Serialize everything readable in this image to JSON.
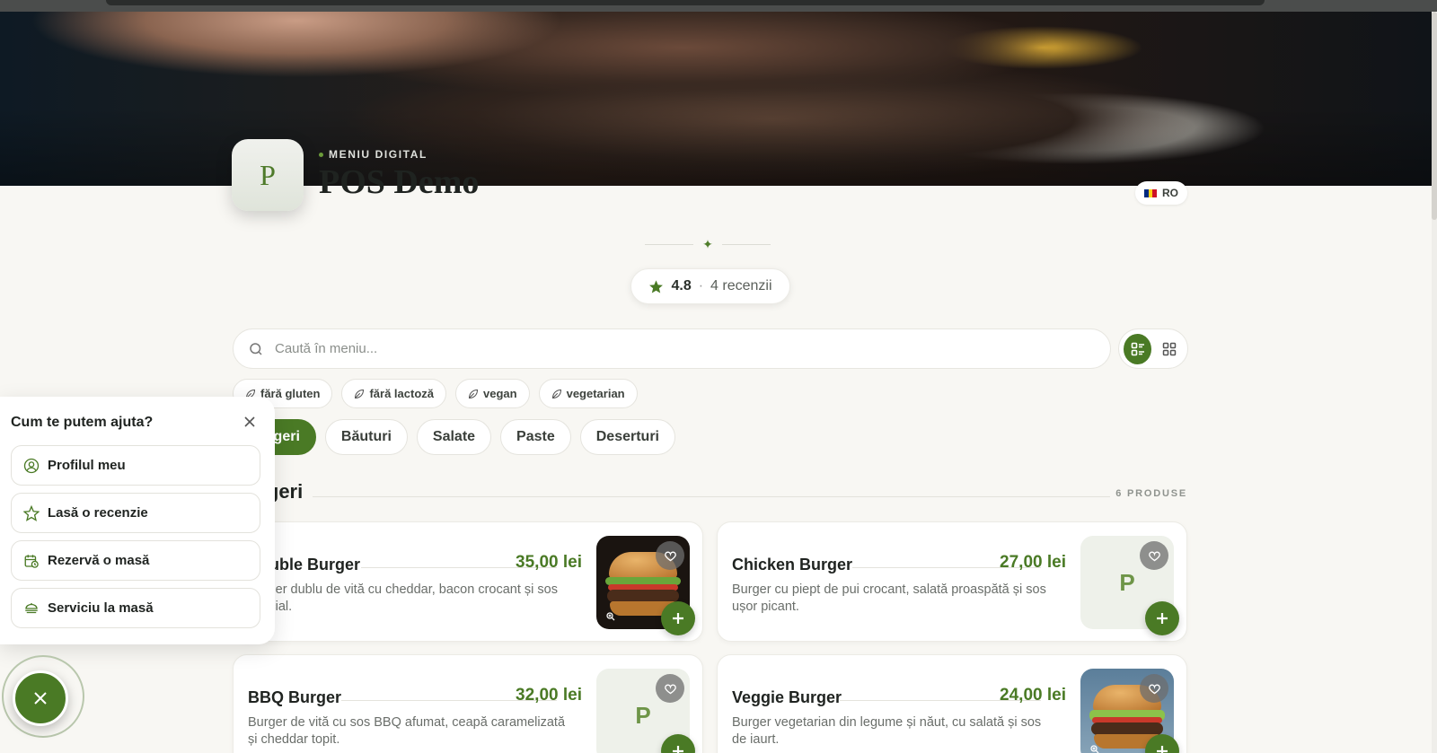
{
  "header": {
    "eyebrow": "MENIU DIGITAL",
    "brand_name": "POS Demo",
    "logo_letter": "P",
    "language": "RO"
  },
  "rating": {
    "score": "4.8",
    "separator": "·",
    "count_label": "4 recenzii"
  },
  "search": {
    "placeholder": "Caută în meniu..."
  },
  "filters": {
    "diet_chips": [
      "fără gluten",
      "fără lactoză",
      "vegan",
      "vegetarian"
    ],
    "categories": [
      "Burgeri",
      "Băuturi",
      "Salate",
      "Paste",
      "Deserturi"
    ],
    "active_category": "Burgeri"
  },
  "section": {
    "title": "Burgeri",
    "count": "6 PRODUSE"
  },
  "products": [
    {
      "name": "Double Burger",
      "price": "35,00 lei",
      "description": "Burger dublu de vită cu cheddar, bacon crocant și sos special.",
      "has_image": true
    },
    {
      "name": "Chicken Burger",
      "price": "27,00 lei",
      "description": "Burger cu piept de pui crocant, salată proaspătă și sos ușor picant.",
      "has_image": false,
      "placeholder_letter": "P"
    },
    {
      "name": "BBQ Burger",
      "price": "32,00 lei",
      "description": "Burger de vită cu sos BBQ afumat, ceapă caramelizată și cheddar topit.",
      "has_image": false,
      "placeholder_letter": "P"
    },
    {
      "name": "Veggie Burger",
      "price": "24,00 lei",
      "description": "Burger vegetarian din legume și năut, cu salată și sos de iaurt.",
      "has_image": true
    }
  ],
  "help_panel": {
    "title": "Cum te putem ajuta?",
    "options": [
      {
        "label": "Profilul meu",
        "icon": "user-circle-icon"
      },
      {
        "label": "Lasă o recenzie",
        "icon": "star-icon"
      },
      {
        "label": "Rezervă o masă",
        "icon": "calendar-clock-icon"
      },
      {
        "label": "Serviciu la masă",
        "icon": "food-dome-icon"
      }
    ]
  },
  "colors": {
    "accent": "#4a7a25",
    "background": "#f8f7f3",
    "price": "#4a7a25"
  }
}
